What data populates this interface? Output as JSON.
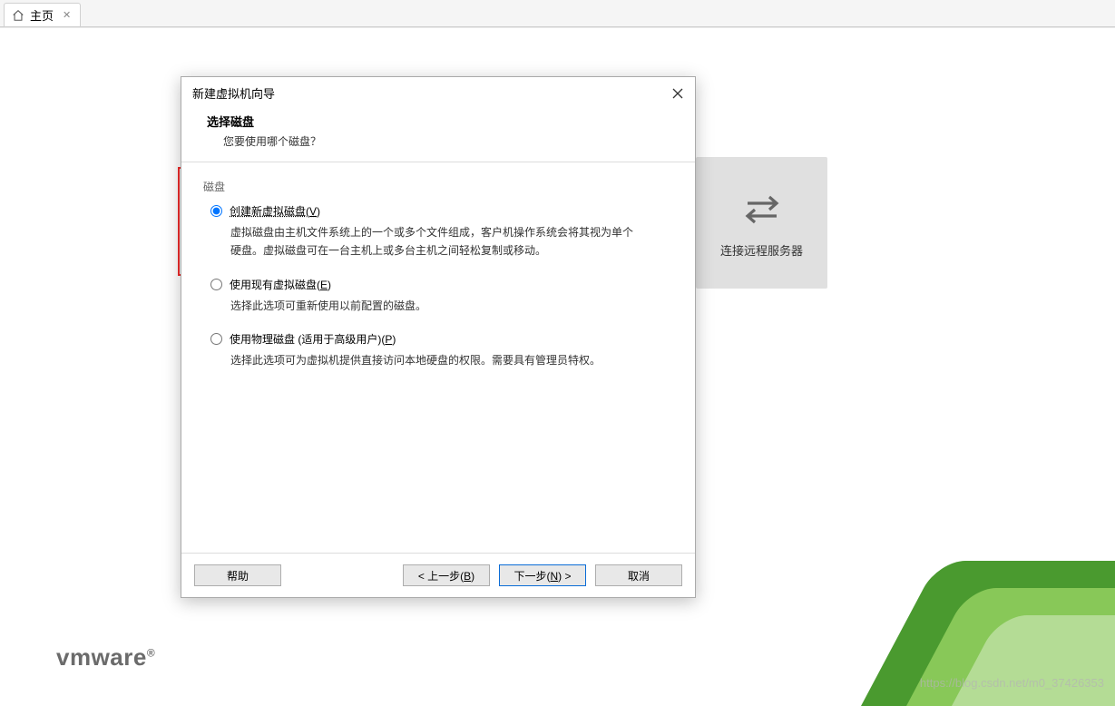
{
  "tabbar": {
    "home_label": "主页"
  },
  "remote_tile": {
    "label": "连接远程服务器"
  },
  "logo": {
    "text": "vmware",
    "reg": "®"
  },
  "watermark": "https://blog.csdn.net/m0_37426353",
  "dialog": {
    "title": "新建虚拟机向导",
    "section_title": "选择磁盘",
    "section_subtitle": "您要使用哪个磁盘？",
    "group_label": "磁盘",
    "options": {
      "opt1": {
        "label_pre": "创建新虚拟磁盘(",
        "hotkey": "V",
        "label_post": ")",
        "desc": "虚拟磁盘由主机文件系统上的一个或多个文件组成，客户机操作系统会将其视为单个硬盘。虚拟磁盘可在一台主机上或多台主机之间轻松复制或移动。"
      },
      "opt2": {
        "label_pre": "使用现有虚拟磁盘(",
        "hotkey": "E",
        "label_post": ")",
        "desc": "选择此选项可重新使用以前配置的磁盘。"
      },
      "opt3": {
        "label_pre": "使用物理磁盘 (适用于高级用户)(",
        "hotkey": "P",
        "label_post": ")",
        "desc": "选择此选项可为虚拟机提供直接访问本地硬盘的权限。需要具有管理员特权。"
      }
    },
    "buttons": {
      "help": "帮助",
      "back_pre": "< 上一步(",
      "back_hotkey": "B",
      "back_post": ")",
      "next_pre": "下一步(",
      "next_hotkey": "N",
      "next_post": ") >",
      "cancel": "取消"
    }
  }
}
